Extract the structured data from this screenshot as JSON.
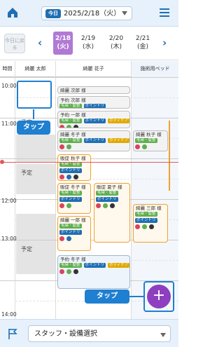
{
  "header": {
    "today_badge": "今日",
    "date_label": "2025/2/18（火）",
    "home_icon": "home-icon",
    "menu_icon": "hamburger-menu-icon"
  },
  "date_strip": {
    "back_to_today": "今日に戻る",
    "days": [
      {
        "date": "2/18",
        "weekday": "(火)",
        "selected": true
      },
      {
        "date": "2/19",
        "weekday": "(水)",
        "selected": false
      },
      {
        "date": "2/20",
        "weekday": "(木)",
        "selected": false
      },
      {
        "date": "2/21",
        "weekday": "(金)",
        "selected": false
      }
    ]
  },
  "columns": {
    "time": "時間",
    "staff1": "綺麗 太郎",
    "staff2": "綺麗 花子",
    "equipment": "施術用ベッド"
  },
  "times": [
    "10:00",
    "11:00",
    "12:00",
    "13:00",
    "14:00"
  ],
  "yotei": "予定",
  "appointments": {
    "a1": "綺麗 次郎 様",
    "a2": "予約 次郎 様",
    "a3": "予約 一郎 様",
    "a4": "綺麗 冬子 様",
    "a5": "販促 秋子 様",
    "a6": "販促 冬子 様",
    "a7": "販促 夏子 様",
    "a8": "綺麗 一郎 様",
    "a9": "予約 冬子 様",
    "a10": "綺麗 秋子 様",
    "a11": "綺麗 三郎 様"
  },
  "tags": {
    "hair": "毛染・髪整",
    "point": "ポイントリ",
    "body": "ボディケア",
    "bodi": "ボディ"
  },
  "callouts": {
    "tap": "タップ"
  },
  "fab": {
    "label": "+"
  },
  "footer": {
    "select_label": "スタッフ・設備選択",
    "flag_icon": "flag-icon"
  },
  "colors": {
    "primary": "#1f6fb3",
    "selected_day": "#b07ad4",
    "fab": "#8e3fbf",
    "now_line": "#e05a5a"
  }
}
